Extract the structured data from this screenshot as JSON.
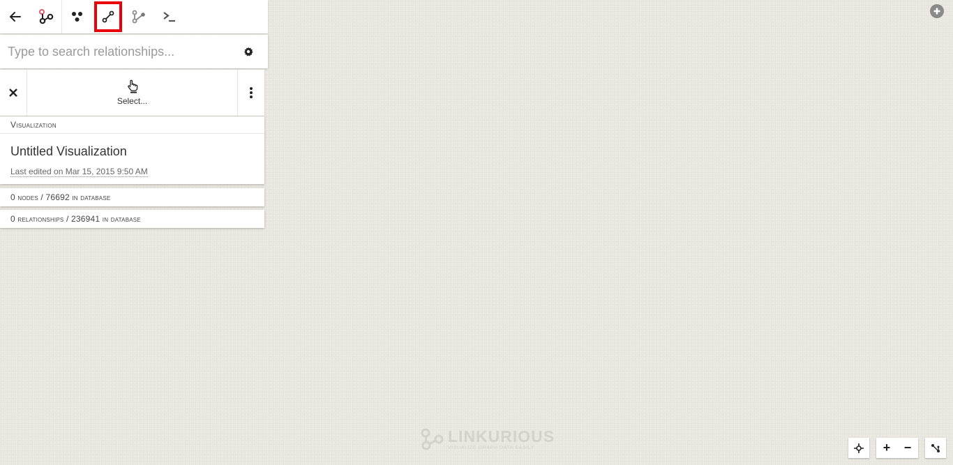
{
  "toolbar": {
    "items": [
      {
        "name": "back",
        "icon": "arrow-left-icon"
      },
      {
        "name": "graph",
        "icon": "graph-icon"
      },
      {
        "name": "nodes",
        "icon": "nodes-icon"
      },
      {
        "name": "relationships",
        "icon": "relationship-icon",
        "active": true
      },
      {
        "name": "path",
        "icon": "path-icon"
      },
      {
        "name": "console",
        "icon": "terminal-icon"
      }
    ],
    "active_outline_color": "#e8000b"
  },
  "search": {
    "placeholder": "Type to search relationships...",
    "value": ""
  },
  "actions": {
    "select_label": "Select..."
  },
  "visualization": {
    "header": "Visualization",
    "title": "Untitled Visualization",
    "last_edited": "Last edited on Mar 15, 2015 9:50 AM"
  },
  "stats": {
    "nodes": "0 nodes / 76692 in database",
    "relationships": "0 relationships / 236941 in database"
  },
  "logo": {
    "name": "LINKURIOUS",
    "tagline": "VISUALIZE GRAPH DATA EASILY"
  },
  "controls": {
    "zoom_in": "+",
    "zoom_out": "−"
  }
}
